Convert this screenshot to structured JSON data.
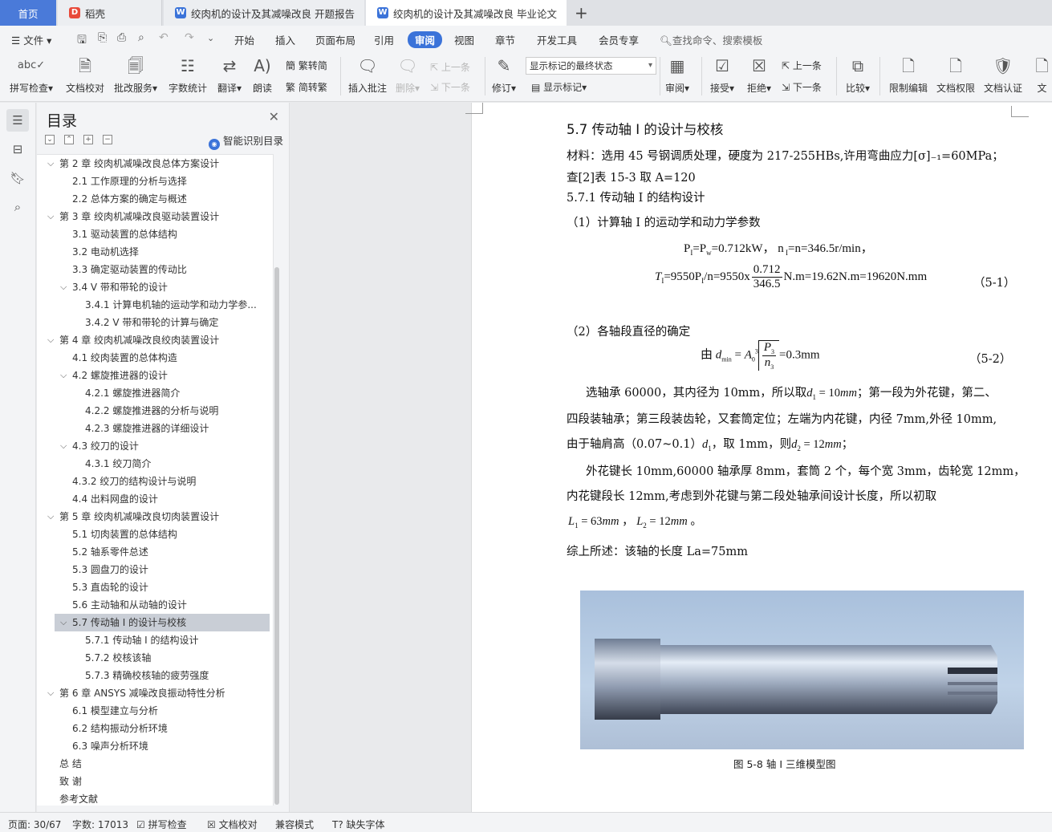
{
  "tabs": {
    "home": "首页",
    "t1": "稻壳",
    "t2": "绞肉机的设计及其减噪改良 开题报告",
    "t3": "绞肉机的设计及其减噪改良 毕业论文"
  },
  "menubar": {
    "file": "文件",
    "items": [
      "开始",
      "插入",
      "页面布局",
      "引用",
      "审阅",
      "视图",
      "章节",
      "开发工具",
      "会员专享"
    ],
    "active": "审阅",
    "search": "查找命令、搜索模板"
  },
  "ribbon": {
    "spell": "拼写检查",
    "doccheck": "文档校对",
    "approve": "批改服务",
    "wordcount": "字数统计",
    "translate": "翻译",
    "read": "朗读",
    "to_trad": "繁转简",
    "to_simp": "简转繁",
    "insert_comment": "插入批注",
    "delete": "删除",
    "prev_comment": "上一条",
    "next_comment": "下一条",
    "track": "修订",
    "markup_select": "显示标记的最终状态",
    "show_markup": "显示标记",
    "review": "审阅",
    "accept": "接受",
    "reject": "拒绝",
    "prev": "上一条",
    "next": "下一条",
    "compare": "比较",
    "restrict": "限制编辑",
    "permission": "文档权限",
    "certify": "文档认证",
    "more": "文"
  },
  "toc": {
    "title": "目录",
    "smart": "智能识别目录",
    "items": [
      {
        "text": "第 2 章  绞肉机减噪改良总体方案设计",
        "level": 1,
        "caret": true
      },
      {
        "text": "2.1  工作原理的分析与选择",
        "level": 2
      },
      {
        "text": "2.2  总体方案的确定与概述",
        "level": 2
      },
      {
        "text": "第 3 章  绞肉机减噪改良驱动装置设计",
        "level": 1,
        "caret": true
      },
      {
        "text": "3.1 驱动装置的总体结构",
        "level": 2
      },
      {
        "text": "3.2  电动机选择",
        "level": 2
      },
      {
        "text": "3.3 确定驱动装置的传动比",
        "level": 2
      },
      {
        "text": "3.4 V 带和带轮的设计",
        "level": 2,
        "caret": true
      },
      {
        "text": "3.4.1  计算电机轴的运动学和动力学参...",
        "level": 3
      },
      {
        "text": "3.4.2 V  带和带轮的计算与确定",
        "level": 3
      },
      {
        "text": "第 4 章  绞肉机减噪改良绞肉装置设计",
        "level": 1,
        "caret": true
      },
      {
        "text": "4.1 绞肉装置的总体构造",
        "level": 2
      },
      {
        "text": "4.2  螺旋推进器的设计",
        "level": 2,
        "caret": true
      },
      {
        "text": "4.2.1 螺旋推进器简介",
        "level": 3
      },
      {
        "text": "4.2.2 螺旋推进器的分析与说明",
        "level": 3
      },
      {
        "text": "4.2.3 螺旋推进器的详细设计",
        "level": 3
      },
      {
        "text": "4.3 绞刀的设计",
        "level": 2,
        "caret": true
      },
      {
        "text": "4.3.1 绞刀简介",
        "level": 3
      },
      {
        "text": "4.3.2 绞刀的结构设计与说明",
        "level": 2
      },
      {
        "text": "4.4 出料网盘的设计",
        "level": 2
      },
      {
        "text": "第 5 章  绞肉机减噪改良切肉装置设计",
        "level": 1,
        "caret": true
      },
      {
        "text": "5.1 切肉装置的总体结构",
        "level": 2
      },
      {
        "text": "5.2 轴系零件总述",
        "level": 2
      },
      {
        "text": "5.3 圆盘刀的设计",
        "level": 2
      },
      {
        "text": "5.3 直齿轮的设计",
        "level": 2
      },
      {
        "text": "5.6 主动轴和从动轴的设计",
        "level": 2
      },
      {
        "text": "5.7 传动轴 I 的设计与校核",
        "level": 2,
        "caret": true,
        "selected": true
      },
      {
        "text": "5.7.1 传动轴 I 的结构设计",
        "level": 3
      },
      {
        "text": "5.7.2 校核该轴",
        "level": 3
      },
      {
        "text": "5.7.3  精确校核轴的疲劳强度",
        "level": 3
      },
      {
        "text": "第 6 章  ANSYS 减噪改良振动特性分析",
        "level": 1,
        "caret": true
      },
      {
        "text": "6.1 模型建立与分析",
        "level": 2
      },
      {
        "text": "6.2 结构振动分析环境",
        "level": 2
      },
      {
        "text": "6.3 噪声分析环境",
        "level": 2
      },
      {
        "text": "总  结",
        "level": 1
      },
      {
        "text": "致    谢",
        "level": 1
      },
      {
        "text": "参考文献",
        "level": 1
      }
    ]
  },
  "doc": {
    "heading": "5.7 传动轴 I 的设计与校核",
    "p1": "材料：选用 45 号钢调质处理，硬度为 217-255HBs,许用弯曲应力[σ]₋₁=60MPa；",
    "p2": "查[2]表 15-3 取 A=120",
    "sub1": "5.7.1 传动轴 I 的结构设计",
    "step1": "（1）计算轴 I 的运动学和动力学参数",
    "f1": "P",
    "f1_text": "=P",
    "f1_rest": "=0.712kW，   n",
    "f1_end": "=n=346.5r/min，",
    "f2_lhs": "=9550P",
    "f2_mid": "/n=9550x",
    "f2_num": "0.712",
    "f2_den": "346.5",
    "f2_rhs": "N.m=19.62N.m=19620N.mm",
    "f2_no": "（5-1）",
    "step2": "（2）各轴段直径的确定",
    "f3_pre": "由",
    "f3_rest": "=0.3mm",
    "f3_no": "（5-2）",
    "p3a": "选轴承 60000，其内径为 10mm，所以取",
    "p3b": "；第一段为外花键，第二、",
    "p4": "四段装轴承；第三段装齿轮，又套筒定位；左端为内花键，内径 7mm,外径 10mm,",
    "p5a": "由于轴肩高（0.07~0.1）",
    "p5b": "，取 1mm，则",
    "p6": "外花键长 10mm,60000 轴承厚 8mm，套筒 2 个，每个宽 3mm，齿轮宽 12mm，",
    "p7": "内花键段长 12mm,考虑到外花键与第二段处轴承间设计长度，所以初取",
    "p8": "综上所述：该轴的长度 La=75mm",
    "caption": "图  5-8  轴 I 三维模型图"
  },
  "status": {
    "page": "页面: 30/67",
    "words": "字数: 17013",
    "spell": "拼写检查",
    "doccheck": "文档校对",
    "compat": "兼容模式",
    "missing_font": "缺失字体"
  }
}
